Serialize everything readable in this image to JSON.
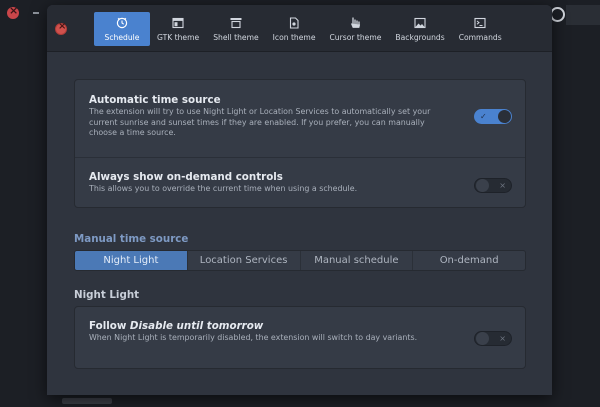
{
  "tabs": [
    {
      "label": "Schedule",
      "icon": "clock-icon",
      "active": true
    },
    {
      "label": "GTK theme",
      "icon": "window-icon",
      "active": false
    },
    {
      "label": "Shell theme",
      "icon": "panel-icon",
      "active": false
    },
    {
      "label": "Icon theme",
      "icon": "file-icon",
      "active": false
    },
    {
      "label": "Cursor theme",
      "icon": "pointer-hand-icon",
      "active": false
    },
    {
      "label": "Backgrounds",
      "icon": "image-icon",
      "active": false
    },
    {
      "label": "Commands",
      "icon": "terminal-icon",
      "active": false
    }
  ],
  "settings": {
    "auto_time": {
      "title": "Automatic time source",
      "description": "The extension will try to use Night Light or Location Services to automatically set your current sunrise and sunset times if they are enabled. If you prefer, you can manually choose a time source.",
      "enabled": true
    },
    "ondemand": {
      "title": "Always show on-demand controls",
      "description": "This allows you to override the current time when using a schedule.",
      "enabled": false
    }
  },
  "manual_source": {
    "title": "Manual time source",
    "options": [
      "Night Light",
      "Location Services",
      "Manual schedule",
      "On-demand"
    ],
    "selected": "Night Light"
  },
  "night_light": {
    "title": "Night Light",
    "follow_prefix": "Follow ",
    "follow_italic": "Disable until tomorrow",
    "description": "When Night Light is temporarily disabled, the extension will switch to day variants.",
    "enabled": false
  },
  "colors": {
    "accent": "#4a82cf",
    "window_bg": "#2f343e",
    "card_bg": "#353b46",
    "close_button": "#d0514d"
  }
}
